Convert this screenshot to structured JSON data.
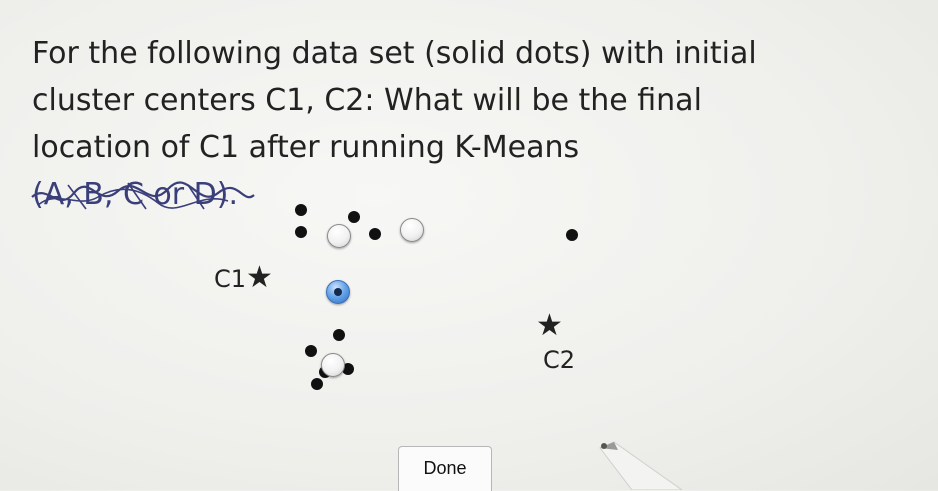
{
  "question": {
    "line1": "For the following data set (solid dots) with initial",
    "line2": "cluster centers C1, C2: What will be the final",
    "line3_prefix": "location of C1 after running K-Means ",
    "line3_scribbled": "(A, B, C or D)."
  },
  "centers": {
    "c1_label": "C1",
    "c2_label": "C2",
    "star_glyph": "★"
  },
  "answer_options": {
    "count": 4,
    "selected_index": 2
  },
  "done_button": {
    "label": "Done"
  },
  "colors": {
    "text": "#222222",
    "dot": "#111111",
    "radio_selected": "#2f6fc4",
    "scribble_ink": "#3a3f7a"
  }
}
